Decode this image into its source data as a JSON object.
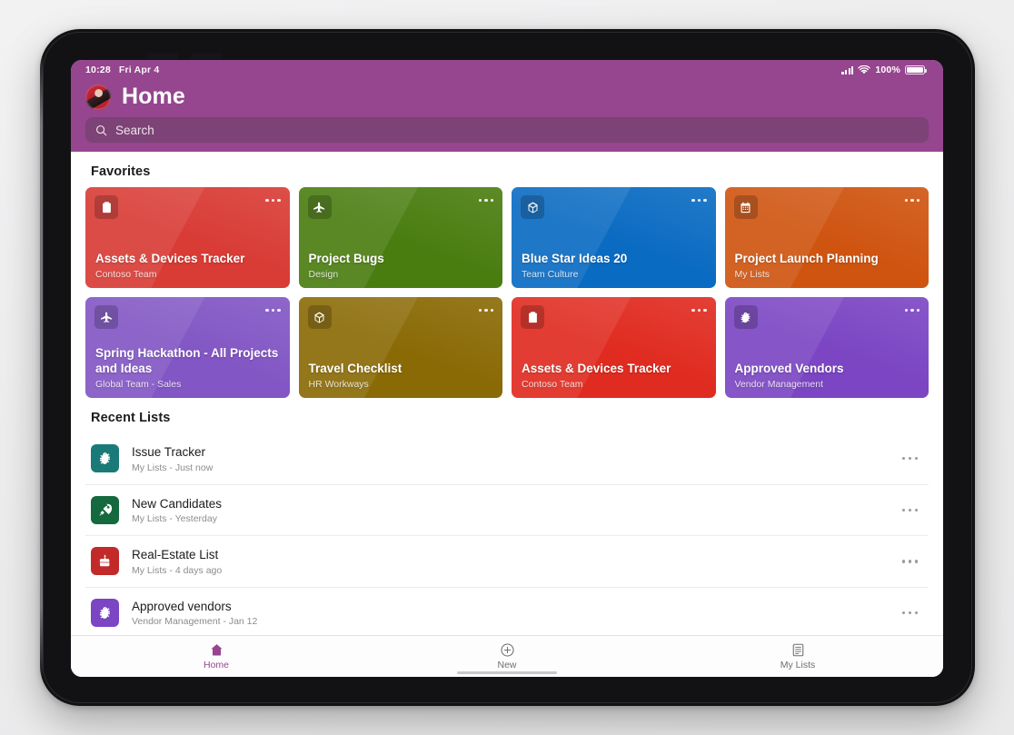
{
  "statusbar": {
    "time": "10:28",
    "date": "Fri Apr 4",
    "battery_percent": "100%",
    "signal_icon": "cellular-signal-icon",
    "wifi_icon": "wifi-icon",
    "battery_icon": "battery-icon"
  },
  "header": {
    "title": "Home",
    "avatar_name": "user-avatar",
    "accent_color": "#96458f",
    "search_bar_color": "#7d4276"
  },
  "search": {
    "placeholder": "Search",
    "value": "",
    "icon": "search-icon"
  },
  "favorites": {
    "title": "Favorites",
    "cards": [
      {
        "name": "Assets & Devices Tracker",
        "sub": "Contoso Team",
        "color": "#d93b35",
        "icon": "clipboard-icon"
      },
      {
        "name": "Project Bugs",
        "sub": "Design",
        "color": "#4a7d10",
        "icon": "airplane-icon"
      },
      {
        "name": "Blue Star Ideas 20",
        "sub": "Team Culture",
        "color": "#0a6bc2",
        "icon": "cube-icon"
      },
      {
        "name": "Project Launch Planning",
        "sub": "My Lists",
        "color": "#cf5410",
        "icon": "calendar-icon"
      },
      {
        "name": "Spring Hackathon - All Projects and Ideas",
        "sub": "Global Team - Sales",
        "color": "#8256c4",
        "icon": "airplane-icon"
      },
      {
        "name": "Travel Checklist",
        "sub": "HR Workways",
        "color": "#8a6a05",
        "icon": "cube-icon"
      },
      {
        "name": "Assets & Devices Tracker",
        "sub": "Contoso Team",
        "color": "#e02b20",
        "icon": "clipboard-icon"
      },
      {
        "name": "Approved Vendors",
        "sub": "Vendor Management",
        "color": "#7b45c3",
        "icon": "bug-icon"
      }
    ],
    "more_icon": "more-options-icon"
  },
  "recent": {
    "title": "Recent Lists",
    "rows": [
      {
        "name": "Issue Tracker",
        "meta": "My Lists - Just now",
        "color": "#1a7a78",
        "icon": "bug-icon"
      },
      {
        "name": "New Candidates",
        "meta": "My Lists - Yesterday",
        "color": "#14693f",
        "icon": "rocket-icon"
      },
      {
        "name": "Real-Estate List",
        "meta": "My Lists - 4 days ago",
        "color": "#c22a2a",
        "icon": "cake-icon"
      },
      {
        "name": "Approved vendors",
        "meta": "Vendor Management - Jan 12",
        "color": "#7b45c3",
        "icon": "bug-icon"
      }
    ],
    "more_icon": "more-options-icon"
  },
  "tabbar": {
    "tabs": [
      {
        "label": "Home",
        "icon": "home-icon",
        "active": true
      },
      {
        "label": "New",
        "icon": "plus-circle-icon",
        "active": false
      },
      {
        "label": "My Lists",
        "icon": "list-icon",
        "active": false
      }
    ],
    "active_color": "#96458f"
  }
}
